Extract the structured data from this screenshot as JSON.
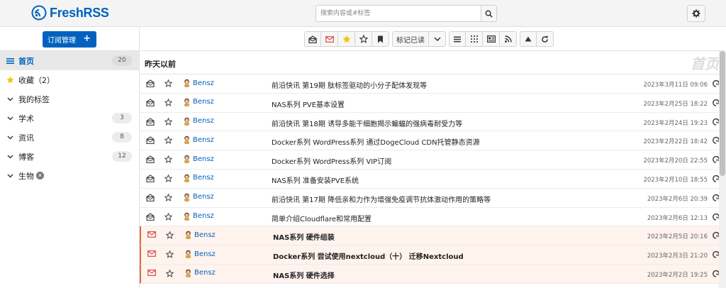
{
  "app": {
    "name": "FreshRSS"
  },
  "header": {
    "search_placeholder": "搜索内容或#标签"
  },
  "sidebar": {
    "subscribe_label": "订阅管理",
    "subscribe_plus": "+",
    "items": [
      {
        "label": "首页",
        "count": "20",
        "icon": "list-icon",
        "active": true
      },
      {
        "label": "收藏（2）",
        "count": "",
        "icon": "star-icon"
      },
      {
        "label": "我的标签",
        "count": "",
        "icon": "chevron-down-icon"
      },
      {
        "label": "学术",
        "count": "3",
        "icon": "chevron-down-icon"
      },
      {
        "label": "资讯",
        "count": "8",
        "icon": "chevron-down-icon"
      },
      {
        "label": "博客",
        "count": "12",
        "icon": "chevron-down-icon"
      },
      {
        "label": "生物",
        "count": "",
        "icon": "chevron-down-icon",
        "badge": "✕"
      }
    ]
  },
  "toolbar": {
    "mark_read_label": "标记已读"
  },
  "main": {
    "day_title": "昨天以前",
    "watermark": "首页",
    "articles": [
      {
        "feed": "Bensz",
        "title": "前沿快讯 第19期 肽标签驱动的小分子配体发现等",
        "date": "2023年3月11日 09:06",
        "unread": false
      },
      {
        "feed": "Bensz",
        "title": "NAS系列 PVE基本设置",
        "date": "2023年2月25日 18:22",
        "unread": false
      },
      {
        "feed": "Bensz",
        "title": "前沿快讯 第18期 诱导多能干细胞揭示蝙蝠的强病毒耐受力等",
        "date": "2023年2月24日 19:23",
        "unread": false
      },
      {
        "feed": "Bensz",
        "title": "Docker系列 WordPress系列 通过DogeCloud CDN托管静态资源",
        "date": "2023年2月22日 18:42",
        "unread": false
      },
      {
        "feed": "Bensz",
        "title": "Docker系列 WordPress系列 VIP订阅",
        "date": "2023年2月20日 22:55",
        "unread": false
      },
      {
        "feed": "Bensz",
        "title": "NAS系列 准备安装PVE系统",
        "date": "2023年2月10日 18:55",
        "unread": false
      },
      {
        "feed": "Bensz",
        "title": "前沿快讯 第17期 降低亲和力作为增强免疫调节抗体激动作用的策略等",
        "date": "2023年2月6日 20:39",
        "unread": false
      },
      {
        "feed": "Bensz",
        "title": "简单介绍Cloudflare和常用配置",
        "date": "2023年2月6日 12:13",
        "unread": false
      },
      {
        "feed": "Bensz",
        "title": "NAS系列 硬件组装",
        "date": "2023年2月5日 20:16",
        "unread": true
      },
      {
        "feed": "Bensz",
        "title": "Docker系列 尝试使用nextcloud（十） 迁移Nextcloud",
        "date": "2023年2月3日 21:20",
        "unread": true
      },
      {
        "feed": "Bensz",
        "title": "NAS系列 硬件选择",
        "date": "2023年2月2日 19:25",
        "unread": true
      }
    ]
  },
  "colors": {
    "accent": "#0062be",
    "unread_bg": "#fff3ee",
    "unread_border": "#e06d3c",
    "unread_mail_icon": "#d9534f",
    "star_yellow": "#f5c400"
  }
}
